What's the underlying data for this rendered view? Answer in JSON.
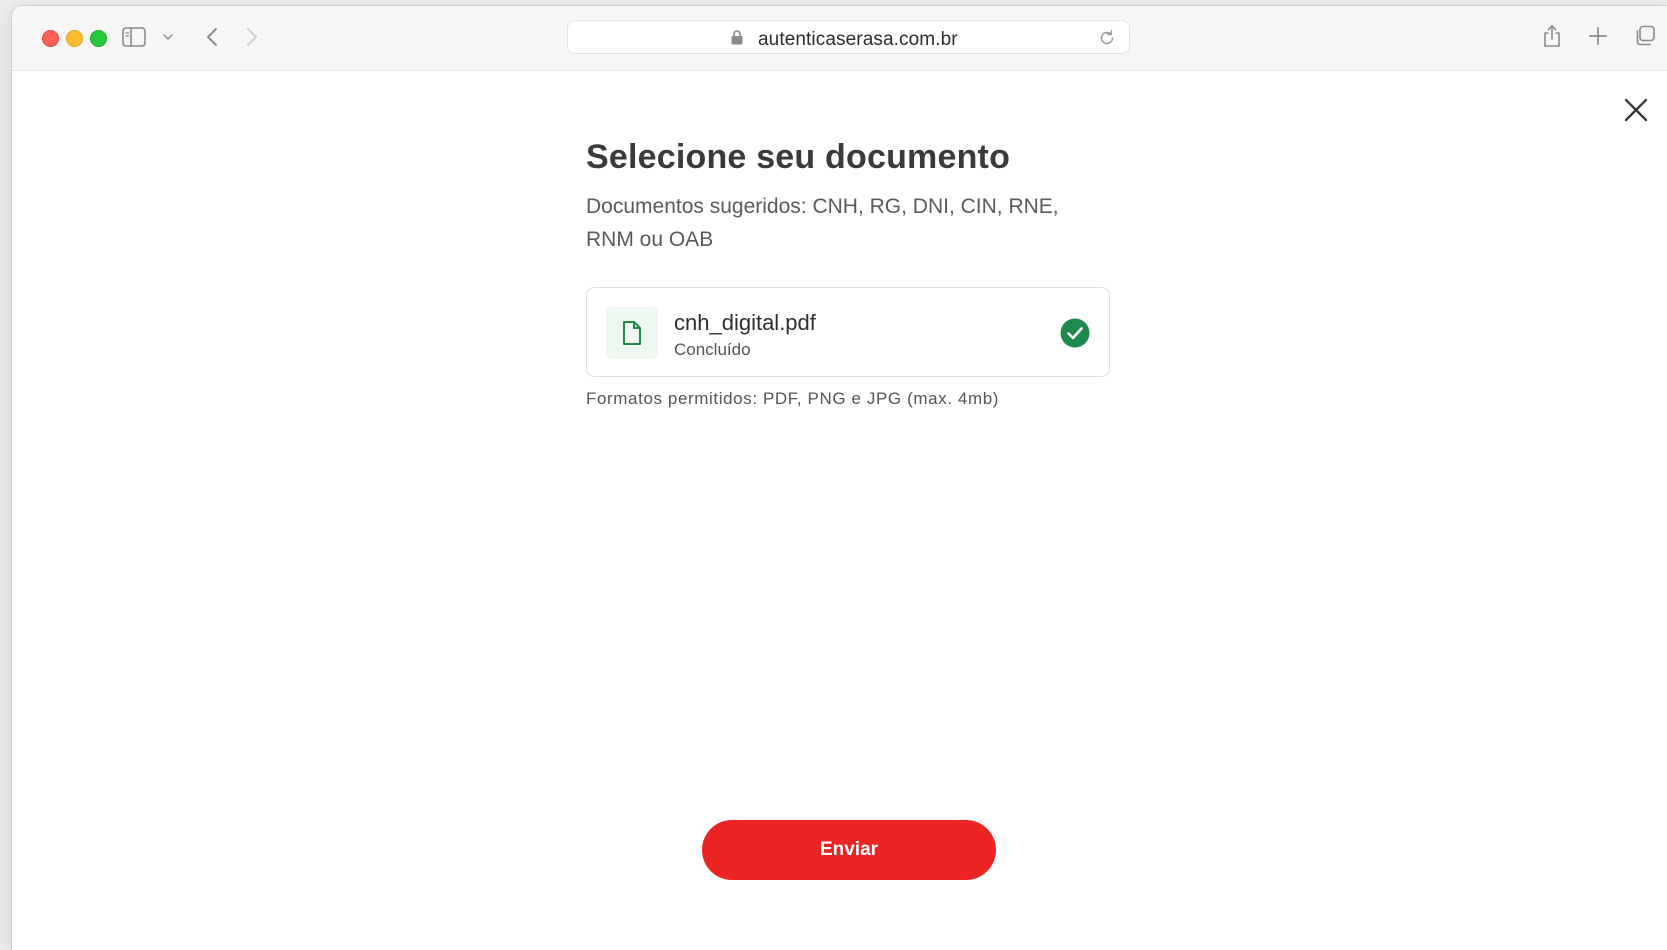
{
  "browser": {
    "url": "autenticaserasa.com.br",
    "icons": {
      "close": "close-window-icon",
      "minimize": "minimize-window-icon",
      "zoom": "zoom-window-icon",
      "sidebar": "sidebar-icon",
      "back": "chevron-left-icon",
      "forward": "chevron-right-icon",
      "lock": "lock-icon",
      "reload": "reload-icon",
      "share": "share-icon",
      "new_tab": "plus-icon",
      "tabs": "tabs-overview-icon"
    }
  },
  "page": {
    "title": "Selecione seu documento",
    "subtitle": "Documentos sugeridos: CNH, RG, DNI, CIN, RNE, RNM ou OAB",
    "file": {
      "name": "cnh_digital.pdf",
      "status": "Concluído",
      "status_icon": "check-circle-icon",
      "file_icon": "document-icon"
    },
    "formats_hint": "Formatos permitidos: PDF, PNG e JPG (max. 4mb)",
    "submit_label": "Enviar",
    "close_icon": "close-icon"
  },
  "colors": {
    "accent": "#ec2424",
    "success": "#1f8a4c",
    "file_thumb_bg": "#eef8f1"
  }
}
